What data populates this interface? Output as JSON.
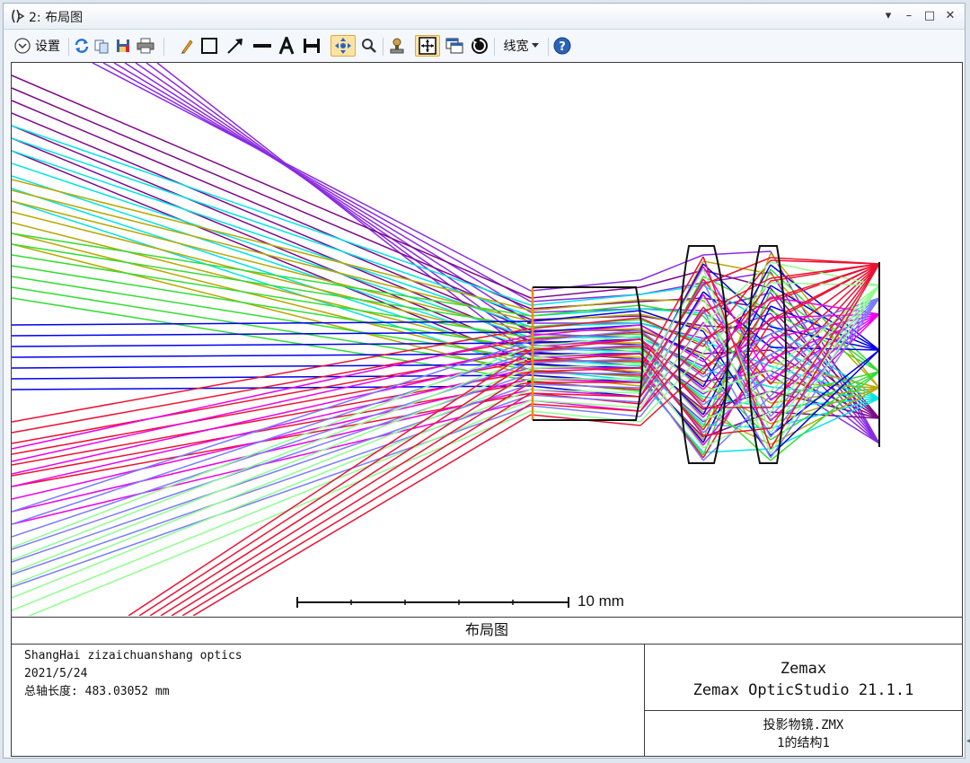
{
  "window": {
    "title": "2: 布局图",
    "controls": [
      "▾",
      "–",
      "□",
      "✕"
    ]
  },
  "toolbar": {
    "settings_label": "设置",
    "linewidth_label": "线宽"
  },
  "plot": {
    "scale_label": "10 mm",
    "caption": "布局图"
  },
  "info": {
    "company": "ShangHai zizaichuanshang optics",
    "date": "2021/5/24",
    "total_track": "总轴长度:  483.03052 mm",
    "brand": "Zemax",
    "product": "Zemax OpticStudio 21.1.1",
    "file": "投影物镜.ZMX",
    "config": "1的结构1"
  },
  "colors": {
    "ray_colors": [
      "#7d0a8a",
      "#8a2be2",
      "#00e5e5",
      "#b8a800",
      "#33dd33",
      "#0000ee",
      "#ee1133",
      "#ee00ee",
      "#7b7bff",
      "#90ff90"
    ]
  }
}
